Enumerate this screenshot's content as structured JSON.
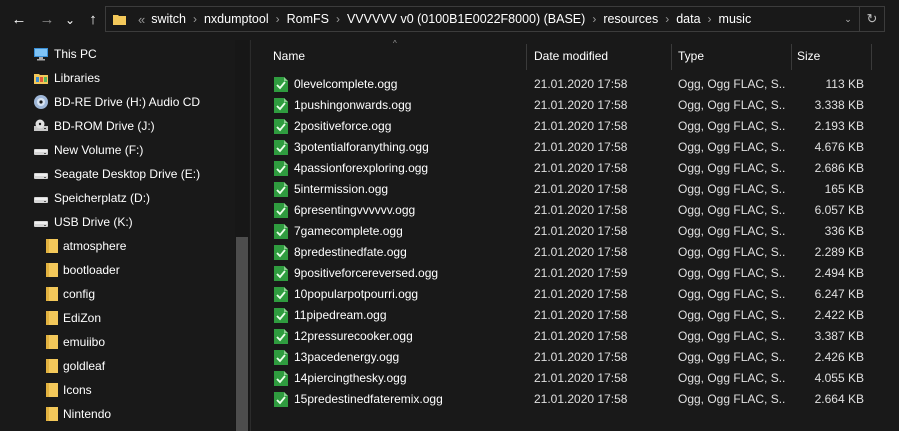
{
  "address": {
    "segments": [
      "switch",
      "nxdumptool",
      "RomFS",
      "VVVVVV v0 (0100B1E0022F8000) (BASE)",
      "resources",
      "data",
      "music"
    ],
    "overflow_glyph": "«",
    "separator": "›"
  },
  "nav_buttons": {
    "back": "←",
    "forward": "→",
    "recent": "⌄",
    "up": "↑",
    "refresh": "↻",
    "dropdown": "⌄"
  },
  "sidebar": {
    "items": [
      {
        "label": "This PC",
        "icon": "pc-icon"
      },
      {
        "label": "Libraries",
        "icon": "libraries-icon"
      },
      {
        "label": "BD-RE Drive (H:) Audio CD",
        "icon": "cd-drive-icon"
      },
      {
        "label": "BD-ROM Drive (J:)",
        "icon": "rom-drive-icon"
      },
      {
        "label": "New Volume (F:)",
        "icon": "drive-icon"
      },
      {
        "label": "Seagate Desktop Drive (E:)",
        "icon": "drive-icon"
      },
      {
        "label": "Speicherplatz (D:)",
        "icon": "drive-icon"
      },
      {
        "label": "USB Drive (K:)",
        "icon": "drive-icon"
      },
      {
        "label": "atmosphere",
        "icon": "folder-icon"
      },
      {
        "label": "bootloader",
        "icon": "folder-icon"
      },
      {
        "label": "config",
        "icon": "folder-icon"
      },
      {
        "label": "EdiZon",
        "icon": "folder-icon"
      },
      {
        "label": "emuiibo",
        "icon": "folder-icon"
      },
      {
        "label": "goldleaf",
        "icon": "folder-icon"
      },
      {
        "label": "Icons",
        "icon": "folder-icon"
      },
      {
        "label": "Nintendo",
        "icon": "folder-icon"
      }
    ]
  },
  "columns": {
    "name": "Name",
    "date": "Date modified",
    "type": "Type",
    "size": "Size"
  },
  "files": [
    {
      "name": "0levelcomplete.ogg",
      "date": "21.01.2020 17:58",
      "type": "Ogg, Ogg FLAC, S...",
      "size": "113 KB"
    },
    {
      "name": "1pushingonwards.ogg",
      "date": "21.01.2020 17:58",
      "type": "Ogg, Ogg FLAC, S...",
      "size": "3.338 KB"
    },
    {
      "name": "2positiveforce.ogg",
      "date": "21.01.2020 17:58",
      "type": "Ogg, Ogg FLAC, S...",
      "size": "2.193 KB"
    },
    {
      "name": "3potentialforanything.ogg",
      "date": "21.01.2020 17:58",
      "type": "Ogg, Ogg FLAC, S...",
      "size": "4.676 KB"
    },
    {
      "name": "4passionforexploring.ogg",
      "date": "21.01.2020 17:58",
      "type": "Ogg, Ogg FLAC, S...",
      "size": "2.686 KB"
    },
    {
      "name": "5intermission.ogg",
      "date": "21.01.2020 17:58",
      "type": "Ogg, Ogg FLAC, S...",
      "size": "165 KB"
    },
    {
      "name": "6presentingvvvvvv.ogg",
      "date": "21.01.2020 17:58",
      "type": "Ogg, Ogg FLAC, S...",
      "size": "6.057 KB"
    },
    {
      "name": "7gamecomplete.ogg",
      "date": "21.01.2020 17:58",
      "type": "Ogg, Ogg FLAC, S...",
      "size": "336 KB"
    },
    {
      "name": "8predestinedfate.ogg",
      "date": "21.01.2020 17:58",
      "type": "Ogg, Ogg FLAC, S...",
      "size": "2.289 KB"
    },
    {
      "name": "9positiveforcereversed.ogg",
      "date": "21.01.2020 17:59",
      "type": "Ogg, Ogg FLAC, S...",
      "size": "2.494 KB"
    },
    {
      "name": "10popularpotpourri.ogg",
      "date": "21.01.2020 17:58",
      "type": "Ogg, Ogg FLAC, S...",
      "size": "6.247 KB"
    },
    {
      "name": "11pipedream.ogg",
      "date": "21.01.2020 17:58",
      "type": "Ogg, Ogg FLAC, S...",
      "size": "2.422 KB"
    },
    {
      "name": "12pressurecooker.ogg",
      "date": "21.01.2020 17:58",
      "type": "Ogg, Ogg FLAC, S...",
      "size": "3.387 KB"
    },
    {
      "name": "13pacedenergy.ogg",
      "date": "21.01.2020 17:58",
      "type": "Ogg, Ogg FLAC, S...",
      "size": "2.426 KB"
    },
    {
      "name": "14piercingthesky.ogg",
      "date": "21.01.2020 17:58",
      "type": "Ogg, Ogg FLAC, S...",
      "size": "4.055 KB"
    },
    {
      "name": "15predestinedfateremix.ogg",
      "date": "21.01.2020 17:58",
      "type": "Ogg, Ogg FLAC, S...",
      "size": "2.664 KB"
    }
  ],
  "colors": {
    "background": "#191919",
    "text": "#ffffff",
    "folder": "#f3c85a",
    "audio_icon": "#2f9c3f"
  }
}
